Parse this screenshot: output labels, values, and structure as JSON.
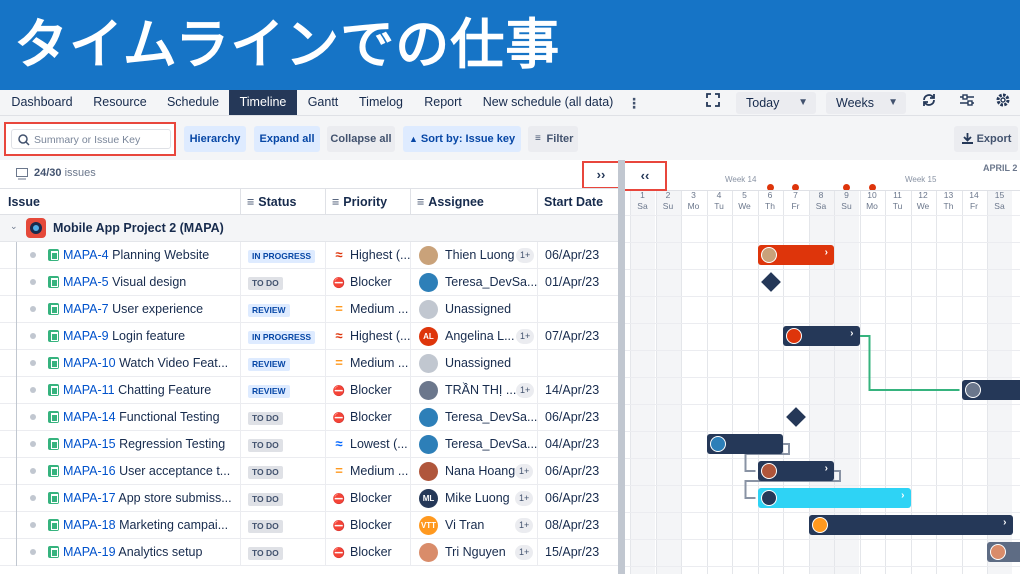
{
  "banner": {
    "title": "タイムラインでの仕事"
  },
  "tabs": [
    {
      "label": "Dashboard"
    },
    {
      "label": "Resource"
    },
    {
      "label": "Schedule"
    },
    {
      "label": "Timeline",
      "active": true
    },
    {
      "label": "Gantt"
    },
    {
      "label": "Timelog"
    },
    {
      "label": "Report"
    },
    {
      "label": "New schedule (all data)"
    }
  ],
  "header_controls": {
    "today": "Today",
    "weeks": "Weeks"
  },
  "toolbar": {
    "search_placeholder": "Summary or Issue Key",
    "hierarchy": "Hierarchy",
    "expand_all": "Expand all",
    "collapse_all": "Collapse all",
    "sort_by": "Sort by: Issue key",
    "filter": "Filter",
    "export": "Export"
  },
  "issues_count": {
    "count": "24/30",
    "label": "issues"
  },
  "columns": {
    "issue": "Issue",
    "status": "Status",
    "priority": "Priority",
    "assignee": "Assignee",
    "start_date": "Start Date"
  },
  "project": {
    "name": "Mobile App Project 2  (MAPA)"
  },
  "rows": [
    {
      "key": "MAPA-4",
      "summary": "Planning Website",
      "status": "IN PROGRESS",
      "priority": "Highest (...",
      "assignee": "Thien Luong",
      "plus": "1+",
      "start": "06/Apr/23"
    },
    {
      "key": "MAPA-5",
      "summary": "Visual design",
      "status": "TO DO",
      "priority": "Blocker",
      "assignee": "Teresa_DevSa...",
      "plus": "",
      "start": "01/Apr/23"
    },
    {
      "key": "MAPA-7",
      "summary": "User experience",
      "status": "REVIEW",
      "priority": "Medium ...",
      "assignee": "Unassigned",
      "plus": "",
      "start": ""
    },
    {
      "key": "MAPA-9",
      "summary": "Login feature",
      "status": "IN PROGRESS",
      "priority": "Highest (...",
      "assignee": "Angelina L...",
      "plus": "1+",
      "start": "07/Apr/23"
    },
    {
      "key": "MAPA-10",
      "summary": "Watch Video Feat...",
      "status": "REVIEW",
      "priority": "Medium ...",
      "assignee": "Unassigned",
      "plus": "",
      "start": ""
    },
    {
      "key": "MAPA-11",
      "summary": "Chatting Feature",
      "status": "REVIEW",
      "priority": "Blocker",
      "assignee": "TRẦN THỊ ...",
      "plus": "1+",
      "start": "14/Apr/23"
    },
    {
      "key": "MAPA-14",
      "summary": "Functional Testing",
      "status": "TO DO",
      "priority": "Blocker",
      "assignee": "Teresa_DevSa...",
      "plus": "",
      "start": "06/Apr/23"
    },
    {
      "key": "MAPA-15",
      "summary": "Regression Testing",
      "status": "TO DO",
      "priority": "Lowest (...",
      "assignee": "Teresa_DevSa...",
      "plus": "",
      "start": "04/Apr/23"
    },
    {
      "key": "MAPA-16",
      "summary": "User acceptance t...",
      "status": "TO DO",
      "priority": "Medium ...",
      "assignee": "Nana Hoang",
      "plus": "1+",
      "start": "06/Apr/23"
    },
    {
      "key": "MAPA-17",
      "summary": "App store submiss...",
      "status": "TO DO",
      "priority": "Blocker",
      "assignee": "Mike Luong",
      "plus": "1+",
      "start": "06/Apr/23"
    },
    {
      "key": "MAPA-18",
      "summary": "Marketing campai...",
      "status": "TO DO",
      "priority": "Blocker",
      "assignee": "Vi Tran",
      "plus": "1+",
      "start": "08/Apr/23"
    },
    {
      "key": "MAPA-19",
      "summary": "Analytics setup",
      "status": "TO DO",
      "priority": "Blocker",
      "assignee": "Tri Nguyen",
      "plus": "1+",
      "start": "15/Apr/23"
    }
  ],
  "avatars": [
    {
      "initials": "",
      "color": "#c9a27a"
    },
    {
      "initials": "",
      "color": "#2d7fb8"
    },
    {
      "initials": "",
      "color": "#c1c7d0"
    },
    {
      "initials": "AL",
      "color": "#de350b"
    },
    {
      "initials": "",
      "color": "#c1c7d0"
    },
    {
      "initials": "",
      "color": "#6b778c"
    },
    {
      "initials": "",
      "color": "#2d7fb8"
    },
    {
      "initials": "",
      "color": "#2d7fb8"
    },
    {
      "initials": "",
      "color": "#b0563b"
    },
    {
      "initials": "ML",
      "color": "#253858"
    },
    {
      "initials": "VTT",
      "color": "#ff991f"
    },
    {
      "initials": "",
      "color": "#d98c6a"
    }
  ],
  "status_colors": {
    "IN PROGRESS": {
      "bg": "#deebff",
      "fg": "#0747a6"
    },
    "TO DO": {
      "bg": "#dfe1e6",
      "fg": "#42526e"
    },
    "REVIEW": {
      "bg": "#deebff",
      "fg": "#0747a6"
    }
  },
  "timeline": {
    "month": "APRIL 2",
    "weeks": [
      "Week 14",
      "Week 15"
    ],
    "days": [
      {
        "n": "1",
        "d": "Sa"
      },
      {
        "n": "2",
        "d": "Su"
      },
      {
        "n": "3",
        "d": "Mo"
      },
      {
        "n": "4",
        "d": "Tu"
      },
      {
        "n": "5",
        "d": "We"
      },
      {
        "n": "6",
        "d": "Th"
      },
      {
        "n": "7",
        "d": "Fr"
      },
      {
        "n": "8",
        "d": "Sa"
      },
      {
        "n": "9",
        "d": "Su"
      },
      {
        "n": "10",
        "d": "Mo"
      },
      {
        "n": "11",
        "d": "Tu"
      },
      {
        "n": "12",
        "d": "We"
      },
      {
        "n": "13",
        "d": "Th"
      },
      {
        "n": "14",
        "d": "Fr"
      },
      {
        "n": "15",
        "d": "Sa"
      }
    ],
    "flag_days": [
      "6",
      "7",
      "9",
      "10"
    ]
  }
}
